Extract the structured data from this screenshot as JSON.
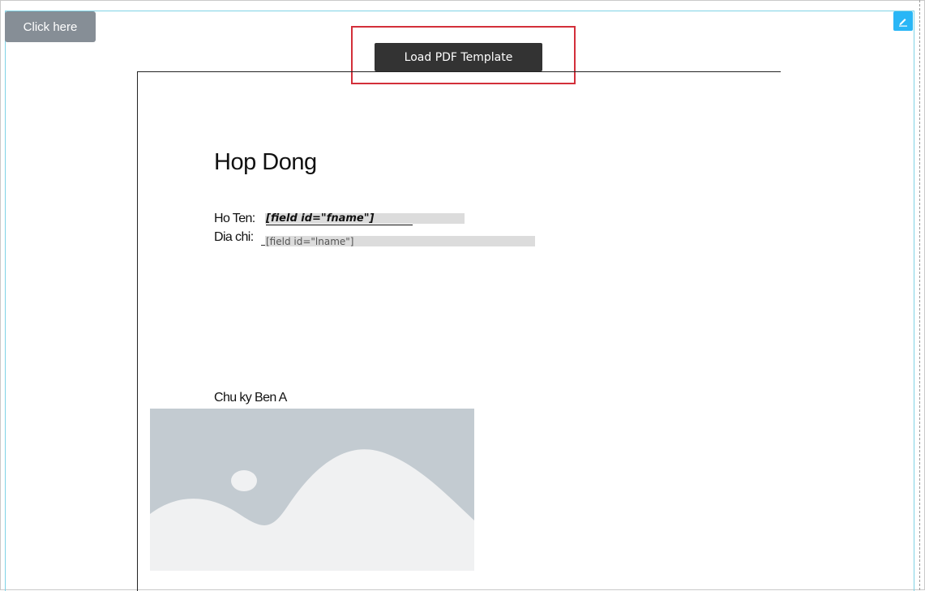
{
  "toolbar": {
    "click_here_label": "Click here",
    "load_template_label": "Load PDF Template",
    "edit_icon": "pencil-icon"
  },
  "document": {
    "title": "Hop Dong",
    "fields": [
      {
        "label": "Ho Ten:",
        "token": "[field id=\"fname\"]"
      },
      {
        "label": "Dia chi:",
        "token": "[field id=\"lname\"]"
      }
    ],
    "signature_label": "Chu ky Ben A",
    "signature_image_icon": "image-placeholder-icon"
  },
  "colors": {
    "click_button_bg": "#868e96",
    "load_button_bg": "#333333",
    "highlight_border": "#d32f3a",
    "edit_button_bg": "#29b6f6",
    "field_bg": "#dcdcdc",
    "image_bg": "#c3cbd1",
    "image_fg": "#f0f1f2"
  }
}
